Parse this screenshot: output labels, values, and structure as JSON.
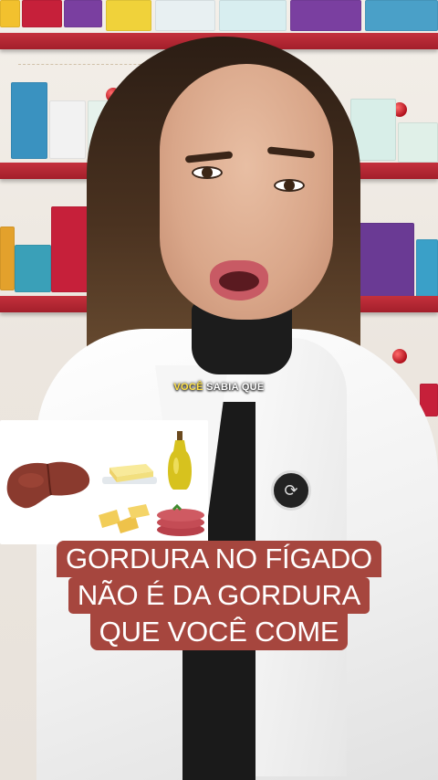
{
  "caption": {
    "highlight": "VOCÊ",
    "rest": " SABIA QUE"
  },
  "headline": {
    "lines": [
      "GORDURA NO FÍGADO",
      "NÃO É DA GORDURA",
      "QUE VOCÊ COME"
    ]
  },
  "inset_image": {
    "items": [
      "liver-icon",
      "butter-icon",
      "olive-oil-icon",
      "cheese-icon",
      "bacon-icon"
    ]
  },
  "colors": {
    "headline_bg": "#a6463e",
    "headline_text": "#ffffff",
    "caption_highlight": "#ffe24a",
    "shelf_red": "#b5202c"
  }
}
